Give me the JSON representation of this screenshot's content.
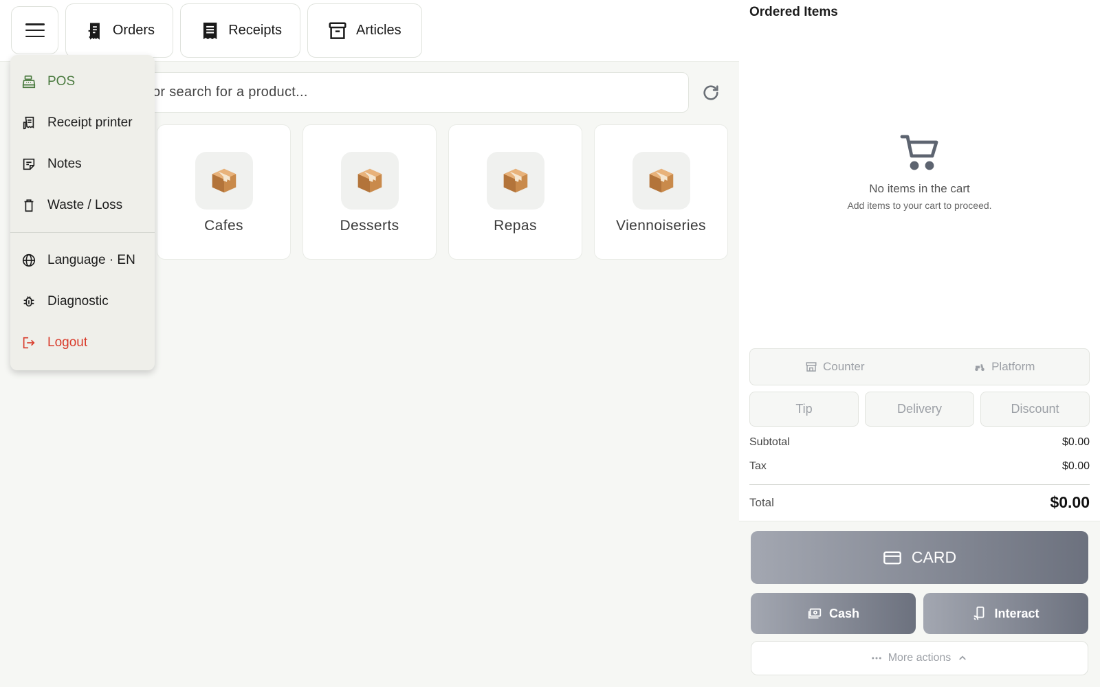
{
  "topbar": {
    "tabs": [
      {
        "label": "Orders",
        "icon": "orders-icon"
      },
      {
        "label": "Receipts",
        "icon": "receipt-icon"
      },
      {
        "label": "Articles",
        "icon": "archive-icon"
      }
    ]
  },
  "search": {
    "placeholder_visible": "or search for a product..."
  },
  "categories": [
    {
      "label": "Cafes",
      "icon": "package-icon"
    },
    {
      "label": "Desserts",
      "icon": "package-icon"
    },
    {
      "label": "Repas",
      "icon": "package-icon"
    },
    {
      "label": "Viennoiseries",
      "icon": "package-icon"
    }
  ],
  "menu": {
    "items": [
      {
        "label": "POS",
        "icon": "cash-register-icon",
        "active": true
      },
      {
        "label": "Receipt printer",
        "icon": "printer-icon"
      },
      {
        "label": "Notes",
        "icon": "notes-icon"
      },
      {
        "label": "Waste / Loss",
        "icon": "trash-icon"
      },
      {
        "label": "Language · EN",
        "icon": "globe-icon"
      },
      {
        "label": "Diagnostic",
        "icon": "bug-icon"
      },
      {
        "label": "Logout",
        "icon": "logout-icon",
        "danger": true
      }
    ]
  },
  "cart": {
    "title": "Ordered Items",
    "empty_title": "No items in the cart",
    "empty_subtitle": "Add items to your cart to proceed.",
    "order_type": {
      "options": [
        "Counter",
        "Platform"
      ]
    },
    "modifiers": [
      "Tip",
      "Delivery",
      "Discount"
    ],
    "subtotal_label": "Subtotal",
    "subtotal_value": "$0.00",
    "tax_label": "Tax",
    "tax_value": "$0.00",
    "total_label": "Total",
    "total_value": "$0.00"
  },
  "payment": {
    "card_label": "CARD",
    "cash_label": "Cash",
    "interact_label": "Interact",
    "more_label": "More actions"
  },
  "colors": {
    "accent_green": "#4a7a3f",
    "danger_red": "#d93b2b",
    "pay_gradient_start": "#a3a7b1",
    "pay_gradient_end": "#6c717e"
  }
}
